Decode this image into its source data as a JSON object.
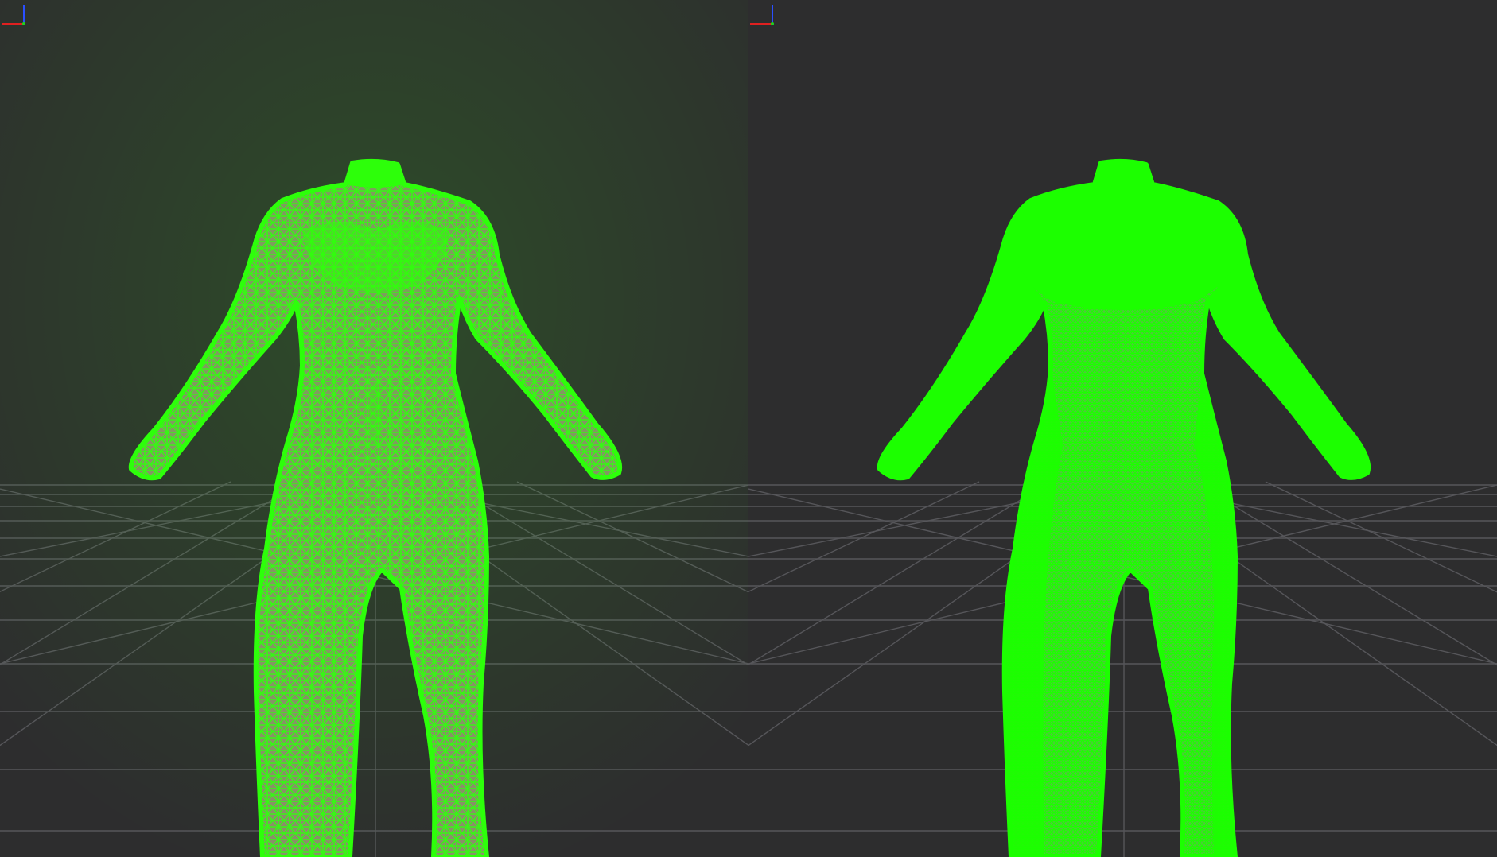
{
  "viewports": [
    {
      "id": "low-poly",
      "mesh_density": "low",
      "mesh_color": "#2dff0a",
      "wire_color": "#3ff21a",
      "skin_color": "#8b8e6a"
    },
    {
      "id": "high-poly",
      "mesh_density": "high",
      "mesh_color": "#1cff00",
      "wire_color": "#24f70c",
      "skin_color": "#6f9e55"
    }
  ],
  "colors": {
    "background": "#2d2d2e",
    "grid_line": "#5a5a5c",
    "grid_axis": "#6a6a6c",
    "axis_x": "#e02020",
    "axis_y": "#2a4fff",
    "axis_z": "#20d020"
  },
  "icons": {
    "axis_gizmo": "xyz-axis-gizmo-icon"
  }
}
